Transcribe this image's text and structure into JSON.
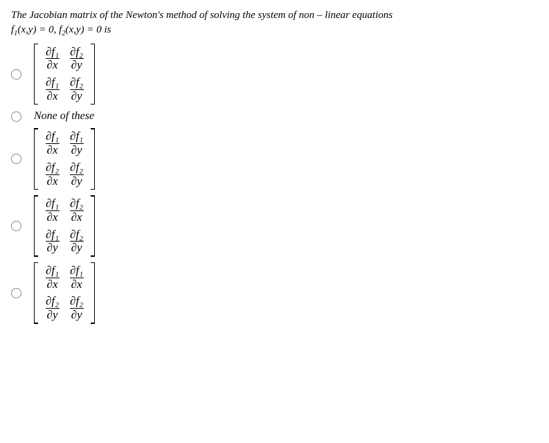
{
  "question": {
    "line1_prefix": "The Jacobian matrix of the Newton's method of solving the system of non",
    "line1_dash": " – ",
    "line1_suffix": "linear equations",
    "line2_f1": "f",
    "line2_sub1": "1",
    "line2_args": "(x,y) = 0,  ",
    "line2_f2": "f",
    "line2_sub2": "2",
    "line2_args2": "(x,y) = 0  is"
  },
  "none_label": "None of these",
  "matA": {
    "r1c1_n": "∂f₁",
    "r1c1_d": "∂x",
    "r1c2_n": "∂f₂",
    "r1c2_d": "∂y",
    "r2c1_n": "∂f₁",
    "r2c1_d": "∂x",
    "r2c2_n": "∂f₂",
    "r2c2_d": "∂y"
  },
  "matC": {
    "r1c1_n": "∂f₁",
    "r1c1_d": "∂x",
    "r1c2_n": "∂f₁",
    "r1c2_d": "∂y",
    "r2c1_n": "∂f₂",
    "r2c1_d": "∂x",
    "r2c2_n": "∂f₂",
    "r2c2_d": "∂y"
  },
  "matD": {
    "r1c1_n": "∂f₁",
    "r1c1_d": "∂x",
    "r1c2_n": "∂f₂",
    "r1c2_d": "∂x",
    "r2c1_n": "∂f₁",
    "r2c1_d": "∂y",
    "r2c2_n": "∂f₂",
    "r2c2_d": "∂y"
  },
  "matE": {
    "r1c1_n": "∂f₁",
    "r1c1_d": "∂x",
    "r1c2_n": "∂f₁",
    "r1c2_d": "∂x",
    "r2c1_n": "∂f₂",
    "r2c1_d": "∂y",
    "r2c2_n": "∂f₂",
    "r2c2_d": "∂y"
  }
}
